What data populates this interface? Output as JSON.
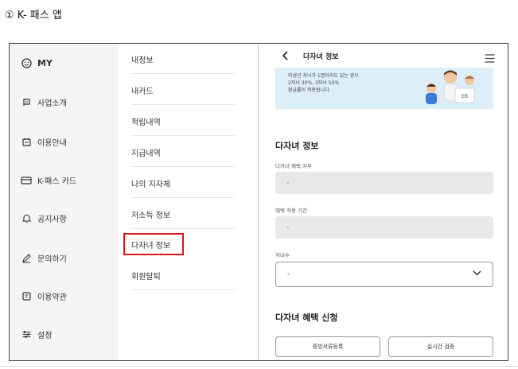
{
  "caption": "① K- 패스 앱",
  "left_menu": {
    "my_label": "MY",
    "items": [
      {
        "label": "사업소개",
        "icon": "notice-icon"
      },
      {
        "label": "이용안내",
        "icon": "calendar-icon"
      },
      {
        "label": "K-패스 카드",
        "icon": "card-icon"
      },
      {
        "label": "공지사항",
        "icon": "bell-icon"
      },
      {
        "label": "문의하기",
        "icon": "pencil-icon"
      },
      {
        "label": "이용약관",
        "icon": "document-icon"
      },
      {
        "label": "설정",
        "icon": "settings-sliders-icon"
      }
    ]
  },
  "sub_menu": {
    "items": [
      "내정보",
      "내카드",
      "적립내역",
      "지급내역",
      "나의 지자체",
      "저소득 정보",
      "다자녀 정보",
      "회원탈퇴"
    ],
    "highlighted_index": 6,
    "highlight_color": "#e0141b"
  },
  "screen": {
    "title": "다자녀 정보",
    "banner_lines": [
      "미성년 자녀가 1명이라도 있는 경우",
      "2자녀 30%, 3자녀 50%",
      "환급률이 적용됩니다"
    ],
    "banner_badge": "EB",
    "section1_title": "다자녀 정보",
    "field1_label": "다자녀 혜택 여부",
    "field1_value": "-",
    "field2_label": "혜택 적용 기간",
    "field2_value": "-",
    "field3_label": "자녀수",
    "field3_value": "-",
    "section2_title": "다자녀 혜택 신청",
    "button1_label": "증빙서류등록",
    "button2_label": "실시간 검증"
  }
}
